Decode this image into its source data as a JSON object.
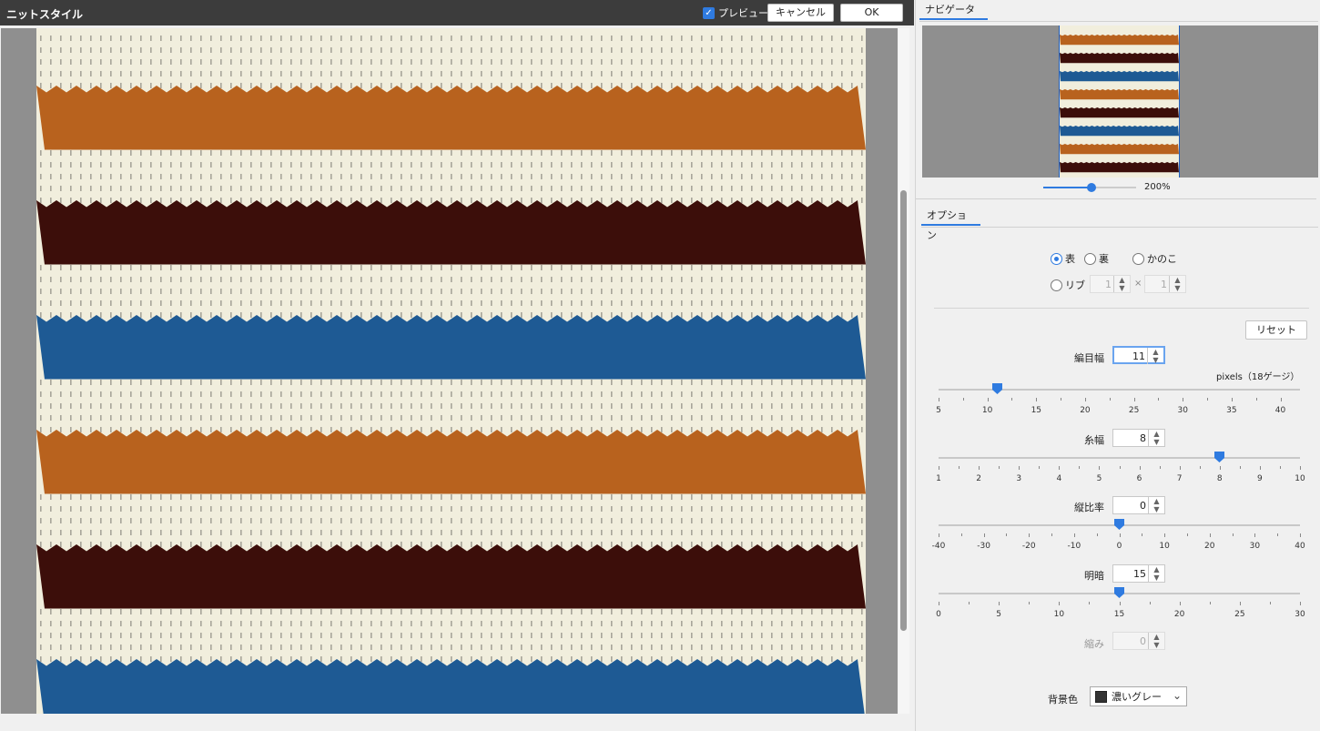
{
  "window": {
    "title": "ニットスタイル"
  },
  "toolbar": {
    "preview_label": "プレビュー",
    "preview_checked": true,
    "cancel_label": "キャンセル",
    "ok_label": "OK"
  },
  "canvas": {
    "stripe_pattern": [
      "cream",
      "orange",
      "cream",
      "darkbrown",
      "cream",
      "blue",
      "cream",
      "orange",
      "cream",
      "darkbrown",
      "cream",
      "blue"
    ],
    "colors": {
      "cream": "#f1eedd",
      "orange": "#b8621e",
      "darkbrown": "#3c0e0a",
      "blue": "#1e5a94",
      "surround": "#8f8f8f"
    }
  },
  "navigator": {
    "tab_label": "ナビゲーター",
    "zoom_label": "200%",
    "zoom_value": 200
  },
  "options": {
    "tab_label": "オプション",
    "stitch_types": [
      {
        "label": "表",
        "selected": true
      },
      {
        "label": "裏",
        "selected": false
      },
      {
        "label": "かのこ",
        "selected": false
      },
      {
        "label": "リブ",
        "selected": false
      }
    ],
    "rib": {
      "a": "1",
      "b": "1",
      "times": "×"
    },
    "reset_label": "リセット",
    "stitch_width": {
      "label": "編目幅",
      "value": "11",
      "unit": "pixels（18ゲージ）",
      "ticks": [
        "5",
        "10",
        "15",
        "20",
        "25",
        "30",
        "35",
        "40"
      ],
      "min": 5,
      "max": 42,
      "current": 11
    },
    "yarn_width": {
      "label": "糸幅",
      "value": "8",
      "ticks": [
        "1",
        "2",
        "3",
        "4",
        "5",
        "6",
        "7",
        "8",
        "9",
        "10"
      ],
      "min": 1,
      "max": 10,
      "current": 8
    },
    "vertical_ratio": {
      "label": "縦比率",
      "value": "0",
      "ticks": [
        "-40",
        "-30",
        "-20",
        "-10",
        "0",
        "10",
        "20",
        "30",
        "40"
      ],
      "min": -40,
      "max": 40,
      "current": 0
    },
    "brightness": {
      "label": "明暗",
      "value": "15",
      "ticks": [
        "0",
        "5",
        "10",
        "15",
        "20",
        "25",
        "30"
      ],
      "min": 0,
      "max": 30,
      "current": 15
    },
    "shrink": {
      "label": "縮み",
      "value": "0"
    },
    "background": {
      "label": "背景色",
      "value": "濃いグレー",
      "swatch": "#333333"
    }
  }
}
